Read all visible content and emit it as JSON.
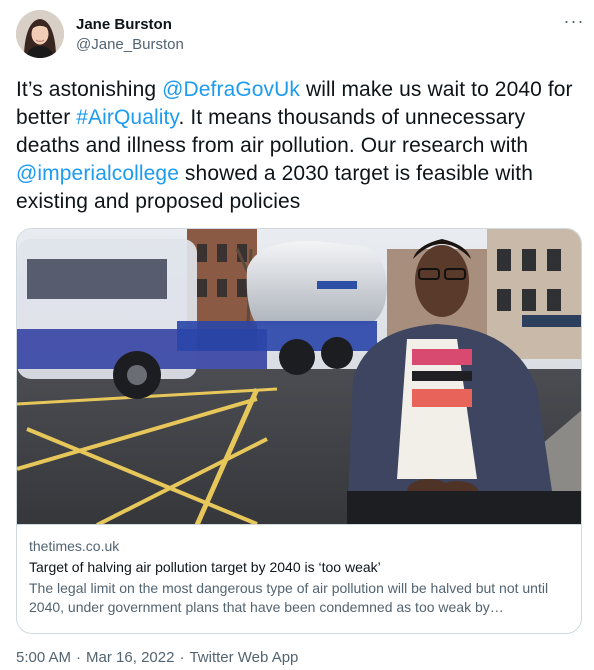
{
  "author": {
    "display_name": "Jane Burston",
    "handle": "@Jane_Burston"
  },
  "tweet": {
    "text_1": "It’s astonishing ",
    "mention_1": "@DefraGovUk",
    "text_2": " will make us wait to 2040 for better ",
    "hashtag_1": "#AirQuality",
    "text_3": ". It means thousands of unnecessary deaths and illness from air pollution. Our research with ",
    "mention_2": "@imperialcollege",
    "text_4": " showed a 2030 target is feasible with existing and proposed policies"
  },
  "card": {
    "domain": "thetimes.co.uk",
    "title": "Target of halving air pollution target by 2040 is ‘too weak’",
    "description": "The legal limit on the most dangerous type of air pollution will be halved but not until 2040, under government plans that have been condemned as too weak by…"
  },
  "meta": {
    "time": "5:00 AM",
    "date": "Mar 16, 2022",
    "source": "Twitter Web App"
  },
  "more_icon": "···",
  "colors": {
    "link": "#1d9bf0",
    "secondary_text": "#536471",
    "primary_text": "#0f1419",
    "border": "#cfd9de"
  }
}
